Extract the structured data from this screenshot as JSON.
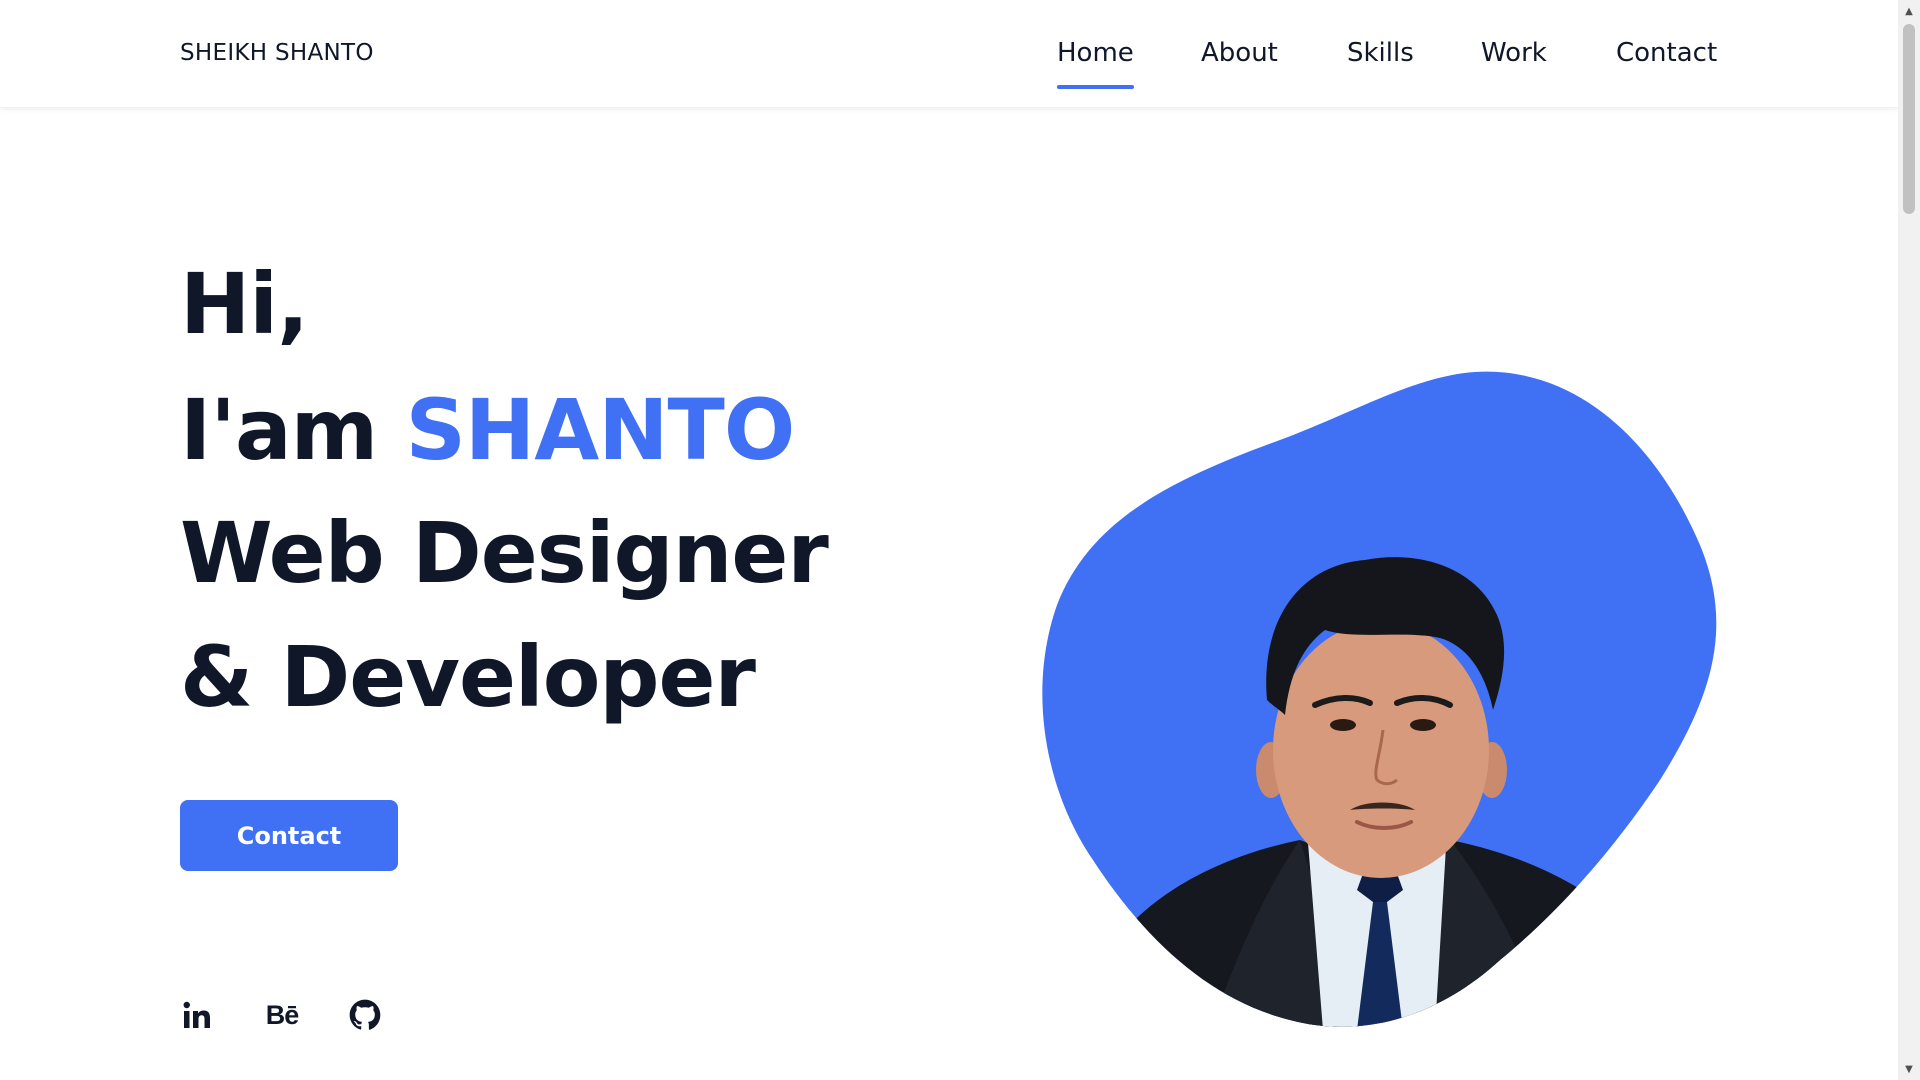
{
  "header": {
    "logo": "SHEIKH SHANTO",
    "nav": [
      {
        "label": "Home",
        "active": true
      },
      {
        "label": "About",
        "active": false
      },
      {
        "label": "Skills",
        "active": false
      },
      {
        "label": "Work",
        "active": false
      },
      {
        "label": "Contact",
        "active": false
      }
    ]
  },
  "hero": {
    "line1": "Hi,",
    "line2_prefix": "I'am ",
    "line2_name": "SHANTO",
    "line3": "Web Designer",
    "line4": "& Developer",
    "button_label": "Contact"
  },
  "social": [
    {
      "icon": "linkedin-icon",
      "text": "in"
    },
    {
      "icon": "behance-icon",
      "text": "Bē"
    },
    {
      "icon": "github-icon"
    }
  ],
  "colors": {
    "accent": "#4070f4",
    "text": "#0f1729",
    "background": "#ffffff"
  }
}
